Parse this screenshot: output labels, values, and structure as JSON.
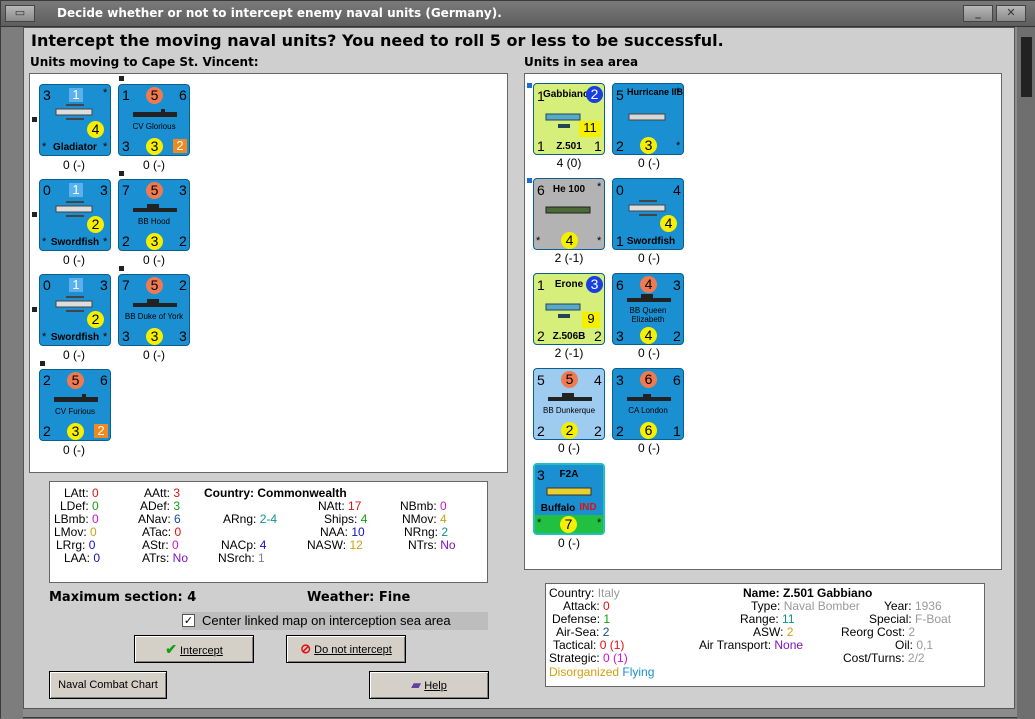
{
  "title": "Decide whether or not to intercept enemy naval units (Germany).",
  "heading": "Intercept the moving naval units?  You need to roll 5 or less to be successful.",
  "left_label": "Units moving to Cape St. Vincent:",
  "right_label": "Units in sea area",
  "colors": {
    "counter_blue": "#1a8fd1",
    "counter_yellowgreen": "#d6ee7a",
    "counter_gray": "#b3b3b3",
    "counter_lightblue": "#9ecbf0",
    "orange": "#f07a50",
    "yellow": "#f6f000"
  },
  "left_units": [
    {
      "name": "Gladiator",
      "a": "3",
      "b": "1",
      "c": "4",
      "d": "*",
      "e": "*",
      "label": "0 (-)"
    },
    {
      "name": "CV Glorious",
      "a": "1",
      "b": "5",
      "c": "6",
      "d": "3",
      "e": "3",
      "f": "2",
      "label": "0 (-)"
    },
    {
      "name": "Swordfish",
      "a": "0",
      "b": "1",
      "c": "3",
      "d": "2",
      "e": "*",
      "label": "0 (-)"
    },
    {
      "name": "BB Hood",
      "a": "7",
      "b": "5",
      "c": "3",
      "d": "2",
      "e": "3",
      "f": "2",
      "label": "0 (-)"
    },
    {
      "name": "Swordfish",
      "a": "0",
      "b": "1",
      "c": "3",
      "d": "2",
      "e": "*",
      "label": "0 (-)"
    },
    {
      "name": "BB Duke of York",
      "a": "7",
      "b": "5",
      "c": "2",
      "d": "3",
      "e": "3",
      "f": "3",
      "label": "0 (-)"
    },
    {
      "name": "CV Furious",
      "a": "2",
      "b": "5",
      "c": "6",
      "d": "2",
      "e": "3",
      "f": "2",
      "label": "0 (-)"
    }
  ],
  "right_units": [
    {
      "name": "Gabbiano",
      "sub": "Z.501",
      "a": "1",
      "b": "2",
      "c": "11",
      "d": "1",
      "e": "1",
      "label": "4 (0)"
    },
    {
      "name": "Hurricane IIB",
      "a": "5",
      "b": "3",
      "c": "2",
      "label": "0 (-)"
    },
    {
      "name": "He 100",
      "a": "6",
      "b": "4",
      "c": "*",
      "label": "2 (-1)"
    },
    {
      "name": "Swordfish",
      "a": "0",
      "b": "4",
      "c": "4",
      "d": "1",
      "label": "0 (-)"
    },
    {
      "name": "Erone",
      "sub": "Z.506B",
      "a": "1",
      "b": "3",
      "c": "9",
      "d": "2",
      "e": "2",
      "label": "2 (-1)"
    },
    {
      "name": "BB Queen Elizabeth",
      "a": "6",
      "b": "4",
      "c": "3",
      "d": "3",
      "e": "4",
      "f": "2",
      "label": "0 (-)"
    },
    {
      "name": "BB Dunkerque",
      "a": "5",
      "b": "5",
      "c": "4",
      "d": "2",
      "e": "2",
      "f": "2",
      "label": "0 (-)"
    },
    {
      "name": "CA London",
      "a": "3",
      "b": "6",
      "c": "6",
      "d": "2",
      "e": "6",
      "f": "1",
      "label": "0 (-)"
    },
    {
      "name": "Buffalo",
      "top": "F2A",
      "a": "3",
      "b": "7",
      "tag": "IND",
      "label": "0 (-)"
    }
  ],
  "stats": {
    "col1": [
      [
        "LAtt:",
        "0"
      ],
      [
        "LDef:",
        "0"
      ],
      [
        "LBmb:",
        "0"
      ],
      [
        "LMov:",
        "0"
      ],
      [
        "LRrg:",
        "0"
      ],
      [
        "LAA:",
        "0"
      ]
    ],
    "col2": [
      [
        "AAtt:",
        "3"
      ],
      [
        "ADef:",
        "3"
      ],
      [
        "ANav:",
        "6"
      ],
      [
        "ATac:",
        "0"
      ],
      [
        "AStr:",
        "0"
      ],
      [
        "ATrs:",
        "No"
      ]
    ],
    "country": "Country: Commonwealth",
    "col3": [
      [
        "ARng:",
        "2-4"
      ],
      [
        "NACp:",
        "4"
      ],
      [
        "NSrch:",
        "1"
      ]
    ],
    "col4": [
      [
        "NAtt:",
        "17"
      ],
      [
        "Ships:",
        "4"
      ],
      [
        "NAA:",
        "10"
      ],
      [
        "NASW:",
        "12"
      ]
    ],
    "col5": [
      [
        "NBmb:",
        "0"
      ],
      [
        "NMov:",
        "4"
      ],
      [
        "NRng:",
        "2"
      ],
      [
        "NTrs:",
        "No"
      ]
    ]
  },
  "max_section": "Maximum section: 4",
  "weather": "Weather:  Fine",
  "center_checkbox": "Center linked map on interception sea area",
  "buttons": {
    "intercept": "Intercept",
    "no_intercept": "Do not intercept",
    "combat_chart": "Naval Combat Chart",
    "help": "Help"
  },
  "info": {
    "country_l": "Country:",
    "country": "Italy",
    "attack_l": "Attack:",
    "attack": "0",
    "defense_l": "Defense:",
    "defense": "1",
    "airsea_l": "Air-Sea:",
    "airsea": "2",
    "tactical_l": "Tactical:",
    "tactical": "0 (1)",
    "strategic_l": "Strategic:",
    "strategic": "0 (1)",
    "name": "Name: Z.501 Gabbiano",
    "type_l": "Type:",
    "type": "Naval Bomber",
    "year_l": "Year:",
    "year": "1936",
    "range_l": "Range:",
    "range": "11",
    "special_l": "Special:",
    "special": "F-Boat",
    "asw_l": "ASW:",
    "asw": "2",
    "reorg_l": "Reorg Cost:",
    "reorg": "2",
    "airtr_l": "Air Transport:",
    "airtr": "None",
    "oil_l": "Oil:",
    "oil": "0,1",
    "cost_l": "Cost/Turns:",
    "cost": "2/2",
    "status1": "Disorganized",
    "status2": "Flying"
  }
}
